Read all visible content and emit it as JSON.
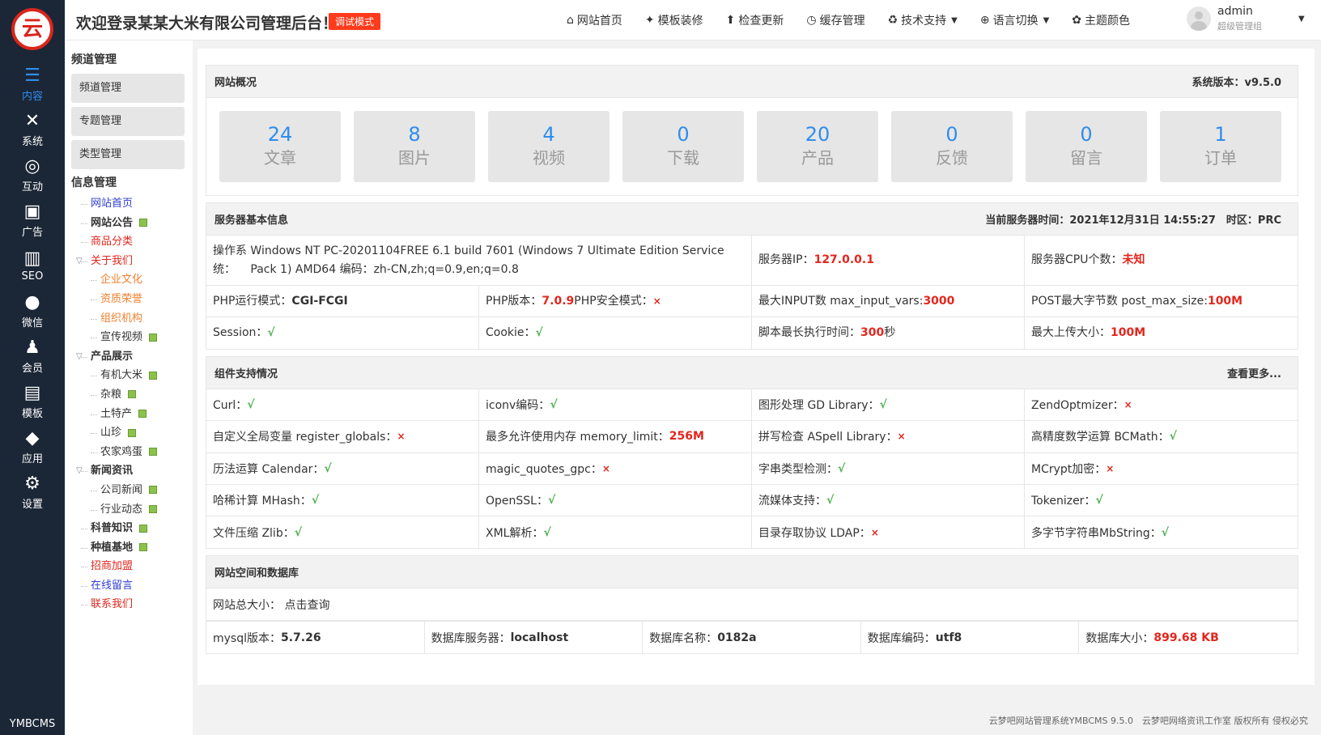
{
  "sidebar": {
    "logo_char": "云",
    "items": [
      {
        "icon": "list-icon",
        "glyph": "☰",
        "label": "内容",
        "active": true
      },
      {
        "icon": "tools-icon",
        "glyph": "✕",
        "label": "系统"
      },
      {
        "icon": "interact-icon",
        "glyph": "◎",
        "label": "互动"
      },
      {
        "icon": "ad-icon",
        "glyph": "▣",
        "label": "广告"
      },
      {
        "icon": "seo-chart-icon",
        "glyph": "▥",
        "label": "SEO"
      },
      {
        "icon": "wechat-icon",
        "glyph": "●",
        "label": "微信"
      },
      {
        "icon": "member-icon",
        "glyph": "♟",
        "label": "会员"
      },
      {
        "icon": "template-icon",
        "glyph": "▤",
        "label": "模板"
      },
      {
        "icon": "app-cube-icon",
        "glyph": "◆",
        "label": "应用"
      },
      {
        "icon": "settings-gear-icon",
        "glyph": "⚙",
        "label": "设置"
      }
    ],
    "brand": "YMBCMS"
  },
  "topbar": {
    "welcome": "欢迎登录某某大米有限公司管理后台！",
    "debug_badge": "调试模式",
    "menu": [
      {
        "icon": "home-icon",
        "glyph": "⌂",
        "label": "网站首页",
        "caret": false
      },
      {
        "icon": "template-icon",
        "glyph": "✦",
        "label": "模板装修",
        "caret": false
      },
      {
        "icon": "upload-icon",
        "glyph": "⬆",
        "label": "检查更新",
        "caret": false
      },
      {
        "icon": "clock-icon",
        "glyph": "◷",
        "label": "缓存管理",
        "caret": false
      },
      {
        "icon": "recycle-icon",
        "glyph": "♻",
        "label": "技术支持",
        "caret": true
      },
      {
        "icon": "globe-icon",
        "glyph": "⊕",
        "label": "语言切换",
        "caret": true
      },
      {
        "icon": "palette-icon",
        "glyph": "✿",
        "label": "主题颜色",
        "caret": false
      }
    ],
    "user": {
      "name": "admin",
      "role": "超级管理组"
    }
  },
  "subnav": {
    "channel_title": "频道管理",
    "channel_buttons": [
      "频道管理",
      "专题管理",
      "类型管理"
    ],
    "info_title": "信息管理",
    "tree": [
      {
        "label": "网站首页",
        "level": 0,
        "color": "#2e3dd3",
        "page": false,
        "toggle": false
      },
      {
        "label": "网站公告",
        "level": 0,
        "color": "#333333",
        "page": true,
        "toggle": false,
        "bold": true
      },
      {
        "label": "商品分类",
        "level": 0,
        "color": "#e3261d",
        "page": false,
        "toggle": false
      },
      {
        "label": "关于我们",
        "level": 0,
        "color": "#e3261d",
        "page": false,
        "toggle": true
      },
      {
        "label": "企业文化",
        "level": 1,
        "color": "#f08030",
        "page": false,
        "toggle": false
      },
      {
        "label": "资质荣誉",
        "level": 1,
        "color": "#f08030",
        "page": false,
        "toggle": false
      },
      {
        "label": "组织机构",
        "level": 1,
        "color": "#f08030",
        "page": false,
        "toggle": false
      },
      {
        "label": "宣传视频",
        "level": 1,
        "color": "#333333",
        "page": true,
        "toggle": false
      },
      {
        "label": "产品展示",
        "level": 0,
        "color": "#333333",
        "page": false,
        "toggle": true,
        "bold": true
      },
      {
        "label": "有机大米",
        "level": 1,
        "color": "#333333",
        "page": true,
        "toggle": false
      },
      {
        "label": "杂粮",
        "level": 1,
        "color": "#333333",
        "page": true,
        "toggle": false
      },
      {
        "label": "土特产",
        "level": 1,
        "color": "#333333",
        "page": true,
        "toggle": false
      },
      {
        "label": "山珍",
        "level": 1,
        "color": "#333333",
        "page": true,
        "toggle": false
      },
      {
        "label": "农家鸡蛋",
        "level": 1,
        "color": "#333333",
        "page": true,
        "toggle": false
      },
      {
        "label": "新闻资讯",
        "level": 0,
        "color": "#333333",
        "page": false,
        "toggle": true,
        "bold": true
      },
      {
        "label": "公司新闻",
        "level": 1,
        "color": "#333333",
        "page": true,
        "toggle": false
      },
      {
        "label": "行业动态",
        "level": 1,
        "color": "#333333",
        "page": true,
        "toggle": false
      },
      {
        "label": "科普知识",
        "level": 0,
        "color": "#333333",
        "page": true,
        "toggle": false,
        "bold": true
      },
      {
        "label": "种植基地",
        "level": 0,
        "color": "#333333",
        "page": true,
        "toggle": false,
        "bold": true
      },
      {
        "label": "招商加盟",
        "level": 0,
        "color": "#e3261d",
        "page": false,
        "toggle": false
      },
      {
        "label": "在线留言",
        "level": 0,
        "color": "#2e3dd3",
        "page": false,
        "toggle": false
      },
      {
        "label": "联系我们",
        "level": 0,
        "color": "#e3261d",
        "page": false,
        "toggle": false
      }
    ]
  },
  "overview": {
    "title": "网站概况",
    "version": "系统版本：v9.5.0",
    "stats": [
      {
        "n": "24",
        "l": "文章"
      },
      {
        "n": "8",
        "l": "图片"
      },
      {
        "n": "4",
        "l": "视频"
      },
      {
        "n": "0",
        "l": "下载"
      },
      {
        "n": "20",
        "l": "产品"
      },
      {
        "n": "0",
        "l": "反馈"
      },
      {
        "n": "0",
        "l": "留言"
      },
      {
        "n": "1",
        "l": "订单"
      }
    ]
  },
  "server": {
    "title": "服务器基本信息",
    "time": "当前服务器时间：2021年12月31日 14:55:27　时区：PRC",
    "rows": [
      [
        {
          "k": "操作系统：",
          "v": "Windows NT PC-20201104FREE 6.1 build 7601 (Windows 7 Ultimate Edition Service Pack 1) AMD64 编码：zh-CN,zh;q=0.9,en;q=0.8",
          "cls": "",
          "span": 2
        },
        {
          "k": "服务器IP：",
          "v": "127.0.0.1",
          "cls": "red"
        },
        {
          "k": "服务器CPU个数：",
          "v": "未知",
          "cls": "red"
        }
      ],
      [
        {
          "k": "PHP运行模式：",
          "v": "CGI-FCGI",
          "cls": "bold"
        },
        {
          "k": "PHP版本：",
          "v": "7.0.9",
          "cls": "red",
          "k2": " PHP安全模式：",
          "v2": "×",
          "cls2": "no"
        },
        {
          "k": "最大INPUT数 max_input_vars: ",
          "v": "3000",
          "cls": "red"
        },
        {
          "k": "POST最大字节数 post_max_size: ",
          "v": "100M",
          "cls": "red"
        }
      ],
      [
        {
          "k": "Session：",
          "v": "√",
          "cls": "ok"
        },
        {
          "k": "Cookie：",
          "v": "√",
          "cls": "ok"
        },
        {
          "k": "脚本最长执行时间：",
          "v": "300",
          "cls": "red",
          "k2": "秒",
          "v2": "",
          "cls2": ""
        },
        {
          "k": "最大上传大小：",
          "v": "100M",
          "cls": "red"
        }
      ]
    ]
  },
  "components": {
    "title": "组件支持情况",
    "more": "查看更多...",
    "cells": [
      {
        "k": "Curl：",
        "v": "√",
        "cls": "ok"
      },
      {
        "k": "iconv编码：",
        "v": "√",
        "cls": "ok"
      },
      {
        "k": "图形处理 GD Library：",
        "v": "√",
        "cls": "ok"
      },
      {
        "k": "ZendOptmizer：",
        "v": "×",
        "cls": "no"
      },
      {
        "k": "自定义全局变量 register_globals：",
        "v": "×",
        "cls": "no"
      },
      {
        "k": "最多允许使用内存 memory_limit：",
        "v": "256M",
        "cls": "red"
      },
      {
        "k": "拼写检查 ASpell Library：",
        "v": "×",
        "cls": "no"
      },
      {
        "k": "高精度数学运算 BCMath：",
        "v": "√",
        "cls": "ok"
      },
      {
        "k": "历法运算 Calendar：",
        "v": "√",
        "cls": "ok"
      },
      {
        "k": "magic_quotes_gpc：",
        "v": "×",
        "cls": "no"
      },
      {
        "k": "字串类型检测：",
        "v": "√",
        "cls": "ok"
      },
      {
        "k": "MCrypt加密：",
        "v": "×",
        "cls": "no"
      },
      {
        "k": "哈稀计算 MHash：",
        "v": "√",
        "cls": "ok"
      },
      {
        "k": "OpenSSL：",
        "v": "√",
        "cls": "ok"
      },
      {
        "k": "流媒体支持：",
        "v": "√",
        "cls": "ok"
      },
      {
        "k": "Tokenizer：",
        "v": "√",
        "cls": "ok"
      },
      {
        "k": "文件压缩 Zlib：",
        "v": "√",
        "cls": "ok"
      },
      {
        "k": "XML解析：",
        "v": "√",
        "cls": "ok"
      },
      {
        "k": "目录存取协议 LDAP：",
        "v": "×",
        "cls": "no"
      },
      {
        "k": "多字节字符串MbString：",
        "v": "√",
        "cls": "ok"
      }
    ]
  },
  "db": {
    "title": "网站空间和数据库",
    "size_label": "网站总大小：",
    "size_link": "点击查询",
    "cells": [
      {
        "k": "mysql版本：",
        "v": "5.7.26",
        "cls": "bold"
      },
      {
        "k": "数据库服务器：",
        "v": "localhost",
        "cls": "bold"
      },
      {
        "k": "数据库名称：",
        "v": "0182a",
        "cls": "bold"
      },
      {
        "k": "数据库编码：",
        "v": "utf8",
        "cls": "bold"
      },
      {
        "k": "数据库大小：",
        "v": "899.68 KB",
        "cls": "red"
      }
    ]
  },
  "footer": "云梦吧网站管理系统YMBCMS 9.5.0　云梦吧网络资讯工作室 版权所有 侵权必究"
}
